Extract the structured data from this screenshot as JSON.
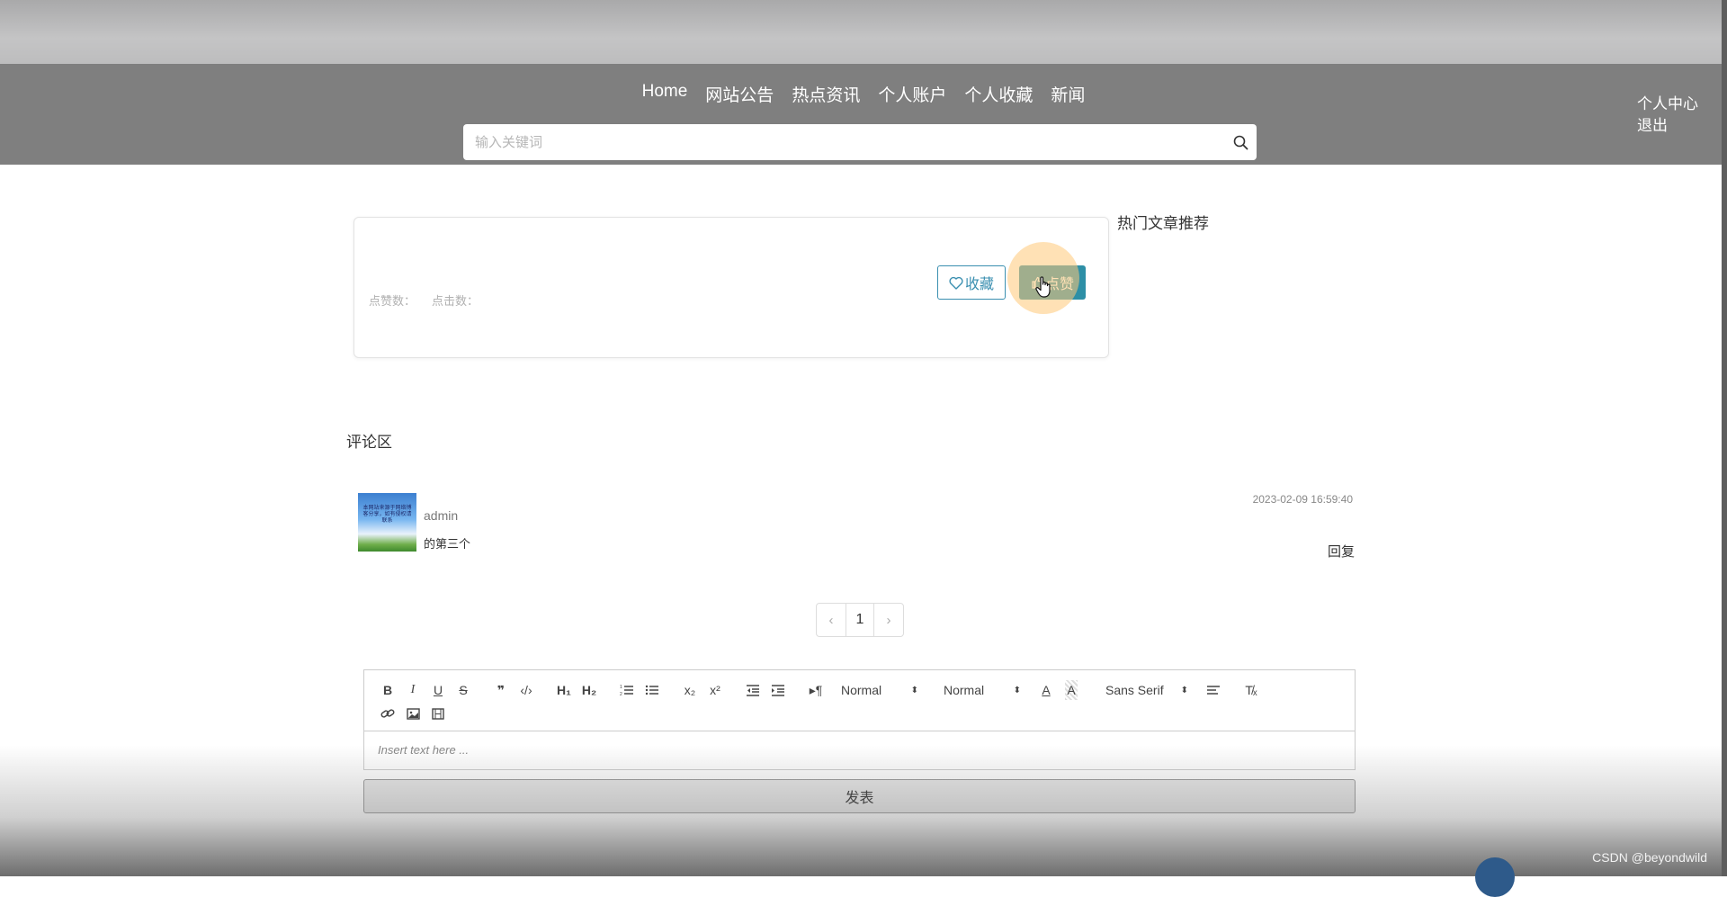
{
  "nav": {
    "links": [
      "Home",
      "网站公告",
      "热点资讯",
      "个人账户",
      "个人收藏",
      "新闻"
    ],
    "user_center": "个人中心",
    "logout": "退出",
    "search_placeholder": "输入关键词"
  },
  "article": {
    "likes_label": "点赞数：",
    "clicks_label": "点击数：",
    "favorite_label": "收藏",
    "like_label": "点赞"
  },
  "sidebar": {
    "hot_title": "热门文章推荐"
  },
  "comments": {
    "title": "评论区",
    "items": [
      {
        "user": "admin",
        "text": "的第三个",
        "time": "2023-02-09 16:59:40",
        "reply": "回复",
        "avatar_caption": "本网站来源于网络博客分享，如有侵权请联系"
      }
    ]
  },
  "pagination": {
    "prev": "‹",
    "current": "1",
    "next": "›"
  },
  "editor": {
    "header_picker": "Normal",
    "size_picker": "Normal",
    "font_picker": "Sans Serif",
    "placeholder": "Insert text here ...",
    "icons": [
      "bold-icon",
      "italic-icon",
      "underline-icon",
      "strike-icon",
      "blockquote-icon",
      "code-icon",
      "h1-icon",
      "h2-icon",
      "ordered-list-icon",
      "bullet-list-icon",
      "subscript-icon",
      "superscript-icon",
      "outdent-icon",
      "indent-icon",
      "rtl-icon",
      "text-color-icon",
      "background-color-icon",
      "align-icon",
      "clean-format-icon",
      "link-icon",
      "image-icon",
      "video-icon"
    ]
  },
  "publish_label": "发表",
  "watermark": "CSDN @beyondwild",
  "colors": {
    "navbar": "#7f7f7f",
    "accent": "#2d8fa6",
    "highlight": "#ffc878"
  }
}
